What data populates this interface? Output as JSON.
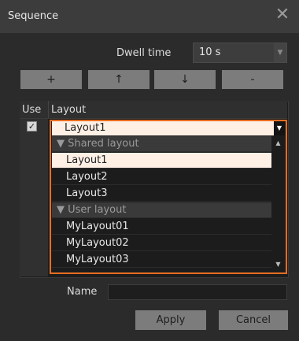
{
  "window": {
    "title": "Sequence",
    "close_icon": "close-icon"
  },
  "dwell": {
    "label": "Dwell time",
    "value": "10 s"
  },
  "toolbar": {
    "add_label": "+",
    "up_label": "↑",
    "down_label": "↓",
    "remove_label": "-"
  },
  "table": {
    "headers": {
      "use": "Use",
      "layout": "Layout"
    },
    "row": {
      "use_checked": true,
      "layout_value": "Layout1"
    }
  },
  "dropdown": {
    "items": [
      {
        "label": "▼ Shared layout",
        "kind": "group"
      },
      {
        "label": "Layout1",
        "kind": "item",
        "selected": true
      },
      {
        "label": "Layout2",
        "kind": "item"
      },
      {
        "label": "Layout3",
        "kind": "item"
      },
      {
        "label": "▼ User layout",
        "kind": "group"
      },
      {
        "label": "MyLayout01",
        "kind": "item"
      },
      {
        "label": "MyLayout02",
        "kind": "item"
      },
      {
        "label": "MyLayout03",
        "kind": "item"
      }
    ]
  },
  "name": {
    "label": "Name",
    "value": ""
  },
  "buttons": {
    "apply": "Apply",
    "cancel": "Cancel"
  },
  "colors": {
    "accent": "#e86d21",
    "button_bg": "#7c7c7c",
    "selected_bg": "#fff0e6"
  }
}
